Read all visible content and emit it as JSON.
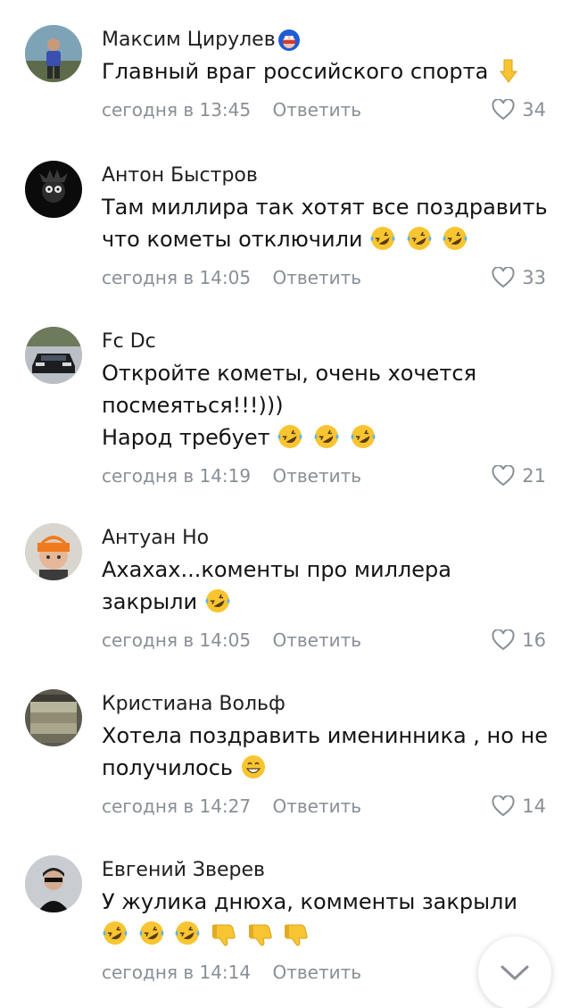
{
  "comments": [
    {
      "author": "Максим Цирулев",
      "badge_icon": "sticker-badge-icon",
      "lines": [
        "Главный враг российского спорта"
      ],
      "emoji_after": [
        "point-down-icon"
      ],
      "time": "сегодня в 13:45",
      "reply_label": "Ответить",
      "likes": "34"
    },
    {
      "author": "Антон Быстров",
      "lines": [
        "Там миллира так хотят все поздравить",
        "что кометы отключили"
      ],
      "emoji_after": [
        "rofl-icon",
        "rofl-icon",
        "rofl-icon"
      ],
      "time": "сегодня в 14:05",
      "reply_label": "Ответить",
      "likes": "33"
    },
    {
      "author": "Fc Dc",
      "lines": [
        "Откройте кометы, очень хочется",
        "посмеяться!!!)))",
        "Народ требует"
      ],
      "emoji_after": [
        "rofl-icon",
        "rofl-icon",
        "rofl-icon"
      ],
      "time": "сегодня в 14:19",
      "reply_label": "Ответить",
      "likes": "21"
    },
    {
      "author": "Антуан Но",
      "lines": [
        "Ахахах...коменты про миллера",
        "закрыли"
      ],
      "emoji_after": [
        "rofl-icon"
      ],
      "time": "сегодня в 14:05",
      "reply_label": "Ответить",
      "likes": "16"
    },
    {
      "author": "Кристиана Вольф",
      "lines": [
        "Хотела поздравить именинника , но не",
        "получилось"
      ],
      "emoji_after": [
        "grin-icon"
      ],
      "time": "сегодня в 14:27",
      "reply_label": "Ответить",
      "likes": "14"
    },
    {
      "author": "Евгений Зверев",
      "lines": [
        "У жулика днюха, комменты закрыли"
      ],
      "emoji_line": [
        "rofl-icon",
        "rofl-icon",
        "rofl-icon",
        "thumbs-down-icon",
        "thumbs-down-icon",
        "thumbs-down-icon"
      ],
      "time": "сегодня в 14:14",
      "reply_label": "Ответить",
      "likes": ""
    }
  ],
  "scroll_button_icon": "chevron-down-icon",
  "colors": {
    "meta_text": "#8a8f96",
    "emoji_yellow": "#f7c531",
    "tear_blue": "#59b4f0"
  }
}
